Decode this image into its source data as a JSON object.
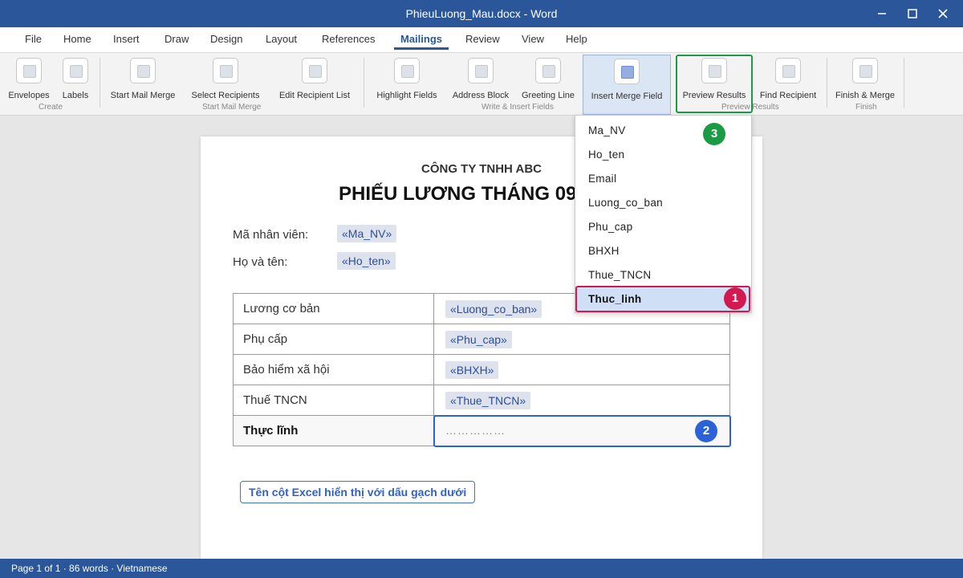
{
  "window": {
    "title": "PhieuLuong_Mau.docx - Word"
  },
  "menu": {
    "tabs": [
      "File",
      "Home",
      "Insert",
      "Draw",
      "Design",
      "Layout",
      "References",
      "Mailings",
      "Review",
      "View",
      "Help"
    ],
    "active": "Mailings"
  },
  "ribbon": {
    "buttons": {
      "envelopes": "Envelopes",
      "labels": "Labels",
      "start_mail_merge": "Start Mail Merge",
      "select_recipients": "Select Recipients",
      "edit_recipient_list": "Edit Recipient List",
      "highlight_fields": "Highlight Fields",
      "address_block": "Address Block",
      "greeting_line": "Greeting Line",
      "insert_merge_field": "Insert Merge Field",
      "preview_results": "Preview Results",
      "find_recipient": "Find Recipient",
      "finish_merge": "Finish & Merge"
    },
    "groups": {
      "create": "Create",
      "start_mail_merge": "Start Mail Merge",
      "write_insert": "Write & Insert Fields",
      "preview": "Preview Results",
      "finish": "Finish"
    }
  },
  "dropdown": {
    "items": [
      "Ma_NV",
      "Ho_ten",
      "Email",
      "Luong_co_ban",
      "Phu_cap",
      "BHXH",
      "Thue_TNCN",
      "Thuc_linh"
    ],
    "selected": "Thuc_linh"
  },
  "document": {
    "company": "CÔNG TY TNHH ABC",
    "title": "PHIẾU LƯƠNG THÁNG 09",
    "fields": [
      {
        "label": "Mã nhân viên:",
        "merge": "«Ma_NV»"
      },
      {
        "label": "Họ và tên:",
        "merge": "«Ho_ten»"
      }
    ],
    "table": [
      {
        "label": "Lương cơ bản",
        "value": "«Luong_co_ban»"
      },
      {
        "label": "Phụ cấp",
        "value": "«Phu_cap»"
      },
      {
        "label": "Bảo hiểm xã hội",
        "value": "«BHXH»"
      },
      {
        "label": "Thuế TNCN",
        "value": "«Thue_TNCN»"
      },
      {
        "label": "Thực lĩnh",
        "value": "……………"
      }
    ],
    "note": "Tên cột Excel hiển thị với dấu gạch dưới"
  },
  "badges": [
    "1",
    "2",
    "3"
  ],
  "colors": {
    "word_blue": "#2b579a",
    "badge_red": "#d21a50",
    "badge_blue": "#2c62d8",
    "badge_green": "#1a9b44"
  },
  "status": {
    "text": "Page 1 of 1 · 86 words · Vietnamese"
  }
}
